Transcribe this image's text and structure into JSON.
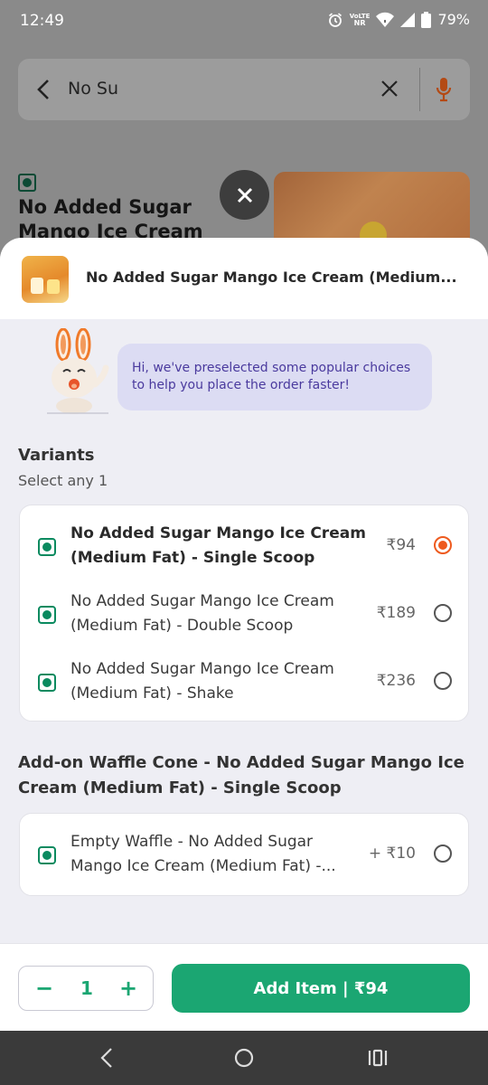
{
  "status": {
    "time": "12:49",
    "network_top": "VoLTE",
    "network_bottom": "NR",
    "battery": "79%"
  },
  "search": {
    "query": "No Su"
  },
  "background_item": {
    "title": "No Added Sugar Mango Ice Cream (Medium Fat)"
  },
  "sheet": {
    "title": "No Added Sugar Mango Ice Cream (Medium...",
    "bubble_text": "Hi, we've preselected some popular choices to help you place the order faster!"
  },
  "variants": {
    "title": "Variants",
    "subtitle": "Select any 1",
    "options": [
      {
        "name": "No Added Sugar Mango Ice Cream (Medium Fat) - Single Scoop",
        "price": "₹94",
        "selected": true
      },
      {
        "name": "No Added Sugar Mango Ice Cream (Medium Fat) - Double Scoop",
        "price": "₹189",
        "selected": false
      },
      {
        "name": "No Added Sugar Mango Ice Cream (Medium Fat) - Shake",
        "price": "₹236",
        "selected": false
      }
    ]
  },
  "addon": {
    "title": "Add-on Waffle Cone - No Added Sugar Mango Ice Cream (Medium Fat) - Single Scoop",
    "options": [
      {
        "name": "Empty Waffle - No Added Sugar Mango Ice Cream (Medium Fat) -...",
        "price": "+ ₹10",
        "selected": false
      }
    ]
  },
  "footer": {
    "minus": "−",
    "quantity": "1",
    "plus": "+",
    "add_button": "Add Item | ₹94"
  },
  "colors": {
    "accent_green": "#1ba672",
    "accent_orange": "#ee5a1e",
    "bubble_text": "#4a3a9e"
  }
}
